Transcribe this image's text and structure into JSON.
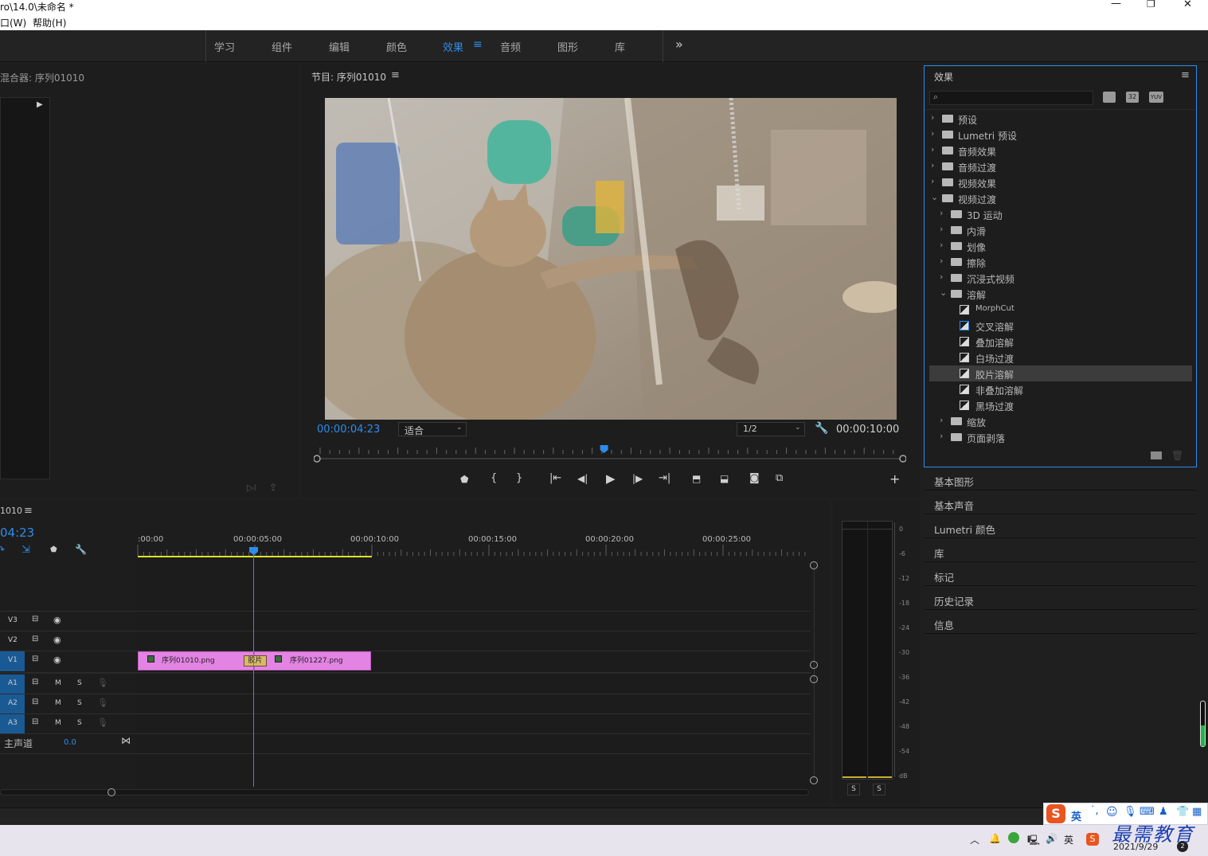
{
  "window": {
    "title": "ro\\14.0\\未命名 *",
    "min": "—",
    "max": "❐",
    "close": "✕"
  },
  "menu": {
    "window": "口(W)",
    "help": "帮助(H)"
  },
  "workspaces": [
    "学习",
    "组件",
    "编辑",
    "颜色",
    "效果",
    "音频",
    "图形",
    "库"
  ],
  "workspaces_active": "效果",
  "workspaces_more": "»",
  "source_panel": {
    "title": "混合器: 序列01010"
  },
  "program": {
    "title": "节目: 序列01010",
    "timecode": "00:00:04:23",
    "fit": "适合",
    "resolution": "1/2",
    "duration": "00:00:10:00",
    "playhead_fraction": 0.49
  },
  "effects": {
    "title": "效果",
    "search_placeholder": "",
    "badges": [
      "32",
      "YUV"
    ],
    "tree": [
      {
        "label": "预设",
        "level": 0,
        "kind": "preset",
        "open": false
      },
      {
        "label": "Lumetri 预设",
        "level": 0,
        "kind": "preset",
        "open": false
      },
      {
        "label": "音频效果",
        "level": 0,
        "kind": "folder",
        "open": false
      },
      {
        "label": "音频过渡",
        "level": 0,
        "kind": "folder",
        "open": false
      },
      {
        "label": "视频效果",
        "level": 0,
        "kind": "folder",
        "open": false
      },
      {
        "label": "视频过渡",
        "level": 0,
        "kind": "folder",
        "open": true
      },
      {
        "label": "3D 运动",
        "level": 1,
        "kind": "folder",
        "open": false
      },
      {
        "label": "内滑",
        "level": 1,
        "kind": "folder",
        "open": false
      },
      {
        "label": "划像",
        "level": 1,
        "kind": "folder",
        "open": false
      },
      {
        "label": "擦除",
        "level": 1,
        "kind": "folder",
        "open": false
      },
      {
        "label": "沉浸式视频",
        "level": 1,
        "kind": "folder",
        "open": false
      },
      {
        "label": "溶解",
        "level": 1,
        "kind": "folder",
        "open": true
      },
      {
        "label": "MorphCut",
        "level": 2,
        "kind": "fx"
      },
      {
        "label": "交叉溶解",
        "level": 2,
        "kind": "fx"
      },
      {
        "label": "叠加溶解",
        "level": 2,
        "kind": "fx"
      },
      {
        "label": "白场过渡",
        "level": 2,
        "kind": "fx"
      },
      {
        "label": "胶片溶解",
        "level": 2,
        "kind": "fx",
        "selected": true
      },
      {
        "label": "非叠加溶解",
        "level": 2,
        "kind": "fx"
      },
      {
        "label": "黑场过渡",
        "level": 2,
        "kind": "fx"
      },
      {
        "label": "缩放",
        "level": 1,
        "kind": "folder",
        "open": false
      },
      {
        "label": "页面剥落",
        "level": 1,
        "kind": "folder",
        "open": false
      }
    ]
  },
  "side_panels": [
    "基本图形",
    "基本声音",
    "Lumetri 颜色",
    "库",
    "标记",
    "历史记录",
    "信息"
  ],
  "timeline": {
    "title": "1010",
    "timecode": "04:23",
    "ruler": [
      ":00:00",
      "00:00:05:00",
      "00:00:10:00",
      "00:00:15:00",
      "00:00:20:00",
      "00:00:25:00"
    ],
    "video_tracks": [
      "V3",
      "V2",
      "V1"
    ],
    "audio_tracks": [
      "A1",
      "A2",
      "A3"
    ],
    "m": "M",
    "s": "S",
    "master_label": "主声道",
    "master_value": "0.0",
    "clips": [
      {
        "name": "序列01010.png"
      },
      {
        "name": "序列01227.png"
      }
    ],
    "transition": "胶片"
  },
  "meter": {
    "labels": [
      "0",
      "-6",
      "-12",
      "-18",
      "-24",
      "-30",
      "-36",
      "-42",
      "-48",
      "-54",
      "dB"
    ],
    "solo": [
      "S",
      "S"
    ]
  },
  "taskbar": {
    "ime": "英",
    "date": "2021/9/29",
    "watermark": "最需教育",
    "badge": "2"
  },
  "colors": {
    "accent": "#2d8ceb",
    "clip": "#e383e3",
    "track_blue": "#1a5a94"
  }
}
